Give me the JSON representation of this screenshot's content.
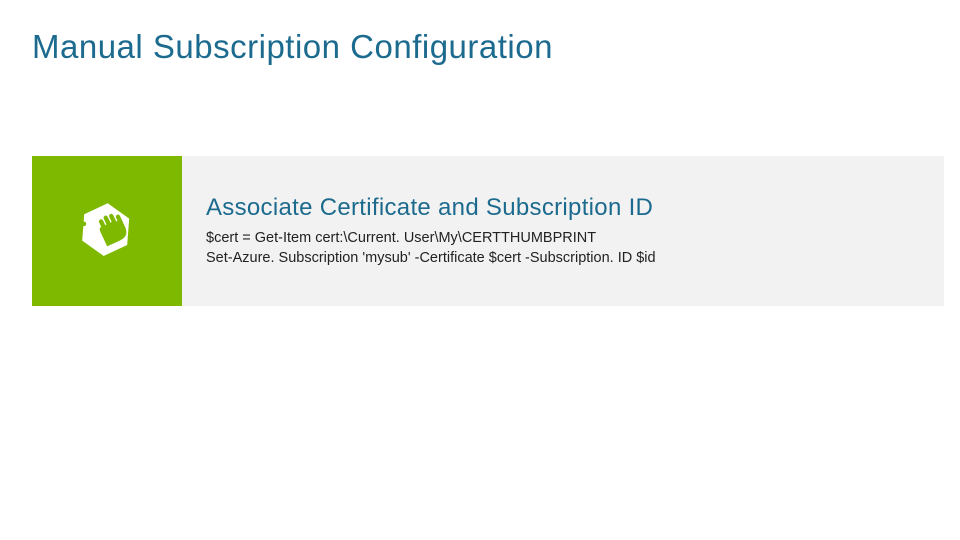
{
  "title": "Manual Subscription Configuration",
  "section": {
    "heading": "Associate Certificate and Subscription ID",
    "code_line_1": "$cert = Get-Item cert:\\Current. User\\My\\CERTTHUMBPRINT",
    "code_line_2": "Set-Azure. Subscription 'mysub' -Certificate $cert -Subscription. ID $id"
  },
  "colors": {
    "accent_blue": "#1c6b8f",
    "tile_green": "#7eb900",
    "panel_gray": "#f2f2f2"
  }
}
